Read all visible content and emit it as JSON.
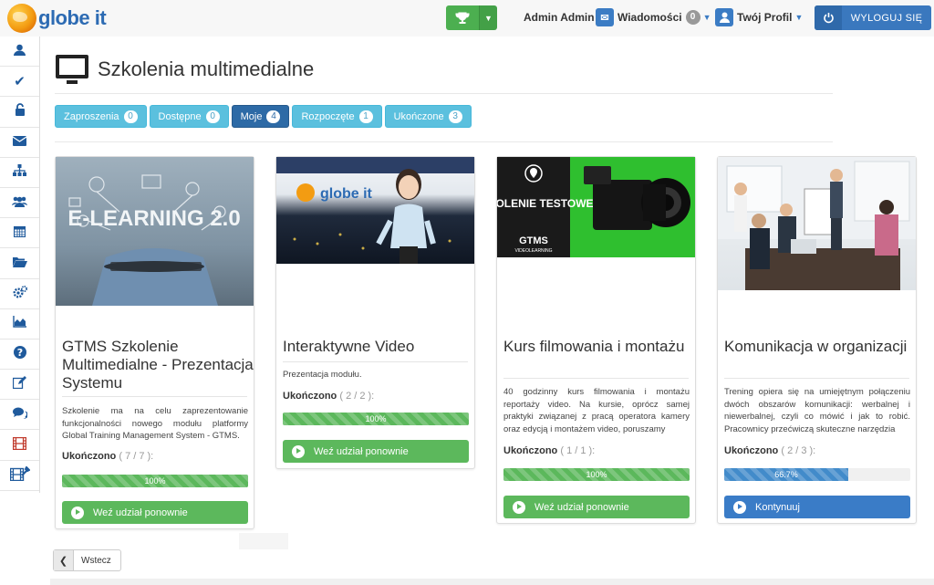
{
  "header": {
    "logo_text": "globe it",
    "admin_name": "Admin Admin",
    "messages_label": "Wiadomości",
    "messages_count": "0",
    "profile_label": "Twój Profil",
    "logout_label": "WYLOGUJ SIĘ"
  },
  "sidebar": {
    "items": [
      {
        "icon": "user-icon"
      },
      {
        "icon": "checkmark-icon"
      },
      {
        "icon": "unlock-icon"
      },
      {
        "icon": "envelope-icon"
      },
      {
        "icon": "sitemap-icon"
      },
      {
        "icon": "users-icon"
      },
      {
        "icon": "calendar-icon"
      },
      {
        "icon": "folder-open-icon"
      },
      {
        "icon": "cogs-icon"
      },
      {
        "icon": "area-chart-icon"
      },
      {
        "icon": "question-icon"
      },
      {
        "icon": "edit-icon"
      },
      {
        "icon": "comments-icon"
      },
      {
        "icon": "film-icon"
      },
      {
        "icon": "film-settings-icon"
      }
    ]
  },
  "page": {
    "title": "Szkolenia multimedialne"
  },
  "tabs": [
    {
      "label": "Zaproszenia",
      "count": "0"
    },
    {
      "label": "Dostępne",
      "count": "0"
    },
    {
      "label": "Moje",
      "count": "4"
    },
    {
      "label": "Rozpoczęte",
      "count": "1"
    },
    {
      "label": "Ukończone",
      "count": "3"
    }
  ],
  "cards": [
    {
      "image_caption": "E-LEARNING 2.0",
      "title": "GTMS Szkolenie Multimedialne - Prezentacja Systemu",
      "description": "Szkolenie ma na celu zaprezentowanie funkcjonalności nowego modułu platformy Global Training Management System - GTMS.",
      "status": "Ukończono",
      "count": "( 7 / 7 ):",
      "progress_label": "100%",
      "progress": 1.0,
      "button": "Weź udział ponownie"
    },
    {
      "image_caption": "globe it",
      "title": "Interaktywne Video",
      "description": "Prezentacja modułu.",
      "status": "Ukończono",
      "count": "( 2 / 2 ):",
      "progress_label": "100%",
      "progress": 1.0,
      "button": "Weź udział ponownie"
    },
    {
      "image_caption": "SZKOLENIE TESTOWE",
      "image_caption2": "GTMS",
      "image_caption3": "VIDEOLEARNING",
      "title": "Kurs filmowania i montażu",
      "description": "40 godzinny kurs filmowania i montażu reportaży video. Na kursie, oprócz samej praktyki związanej z pracą operatora kamery oraz edycją i montażem video, poruszamy",
      "status": "Ukończono",
      "count": "( 1 / 1 ):",
      "progress_label": "100%",
      "progress": 1.0,
      "button": "Weź udział ponownie"
    },
    {
      "title": "Komunikacja w organizacji",
      "description": "Trening opiera się na umiejętnym połączeniu dwóch obszarów komunikacji: werbalnej i niewerbalnej, czyli co mówić i jak to robić. Pracownicy przećwiczą skuteczne narzędzia",
      "status": "Ukończono",
      "count": "( 2 / 3 ):",
      "progress_label": "66.7%",
      "progress": 0.667,
      "button": "Kontynuuj"
    }
  ],
  "back_label": "Wstecz",
  "colors": {
    "primary_blue": "#3a78be",
    "success_green": "#5cb85c",
    "info_cyan": "#5bc0de",
    "active_tab": "#2d6aa6"
  }
}
